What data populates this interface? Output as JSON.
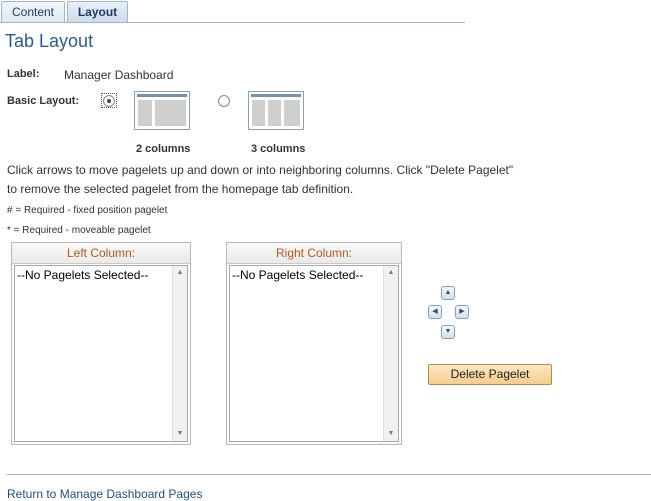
{
  "tabs": [
    {
      "label": "Content",
      "active": false
    },
    {
      "label": "Layout",
      "active": true
    }
  ],
  "page": {
    "title": "Tab Layout"
  },
  "form": {
    "label_caption": "Label:",
    "label_value": "Manager Dashboard",
    "basic_layout_caption": "Basic Layout:",
    "layouts": [
      {
        "caption": "2 columns",
        "selected": true
      },
      {
        "caption": "3 columns",
        "selected": false
      }
    ]
  },
  "instructions": {
    "line1": "Click arrows to move pagelets up and down or into neighboring columns. Click \"Delete Pagelet\"",
    "line2": "to remove the selected pagelet from the homepage tab definition.",
    "required_fixed": "# = Required - fixed position pagelet",
    "required_moveable": "* = Required - moveable pagelet"
  },
  "columns": {
    "left": {
      "header": "Left Column:",
      "items": [
        "--No Pagelets Selected--"
      ]
    },
    "right": {
      "header": "Right Column:",
      "items": [
        "--No Pagelets Selected--"
      ]
    }
  },
  "arrows": {
    "up": "up-arrow-icon",
    "left": "left-arrow-icon",
    "right": "right-arrow-icon",
    "down": "down-arrow-icon"
  },
  "buttons": {
    "delete_pagelet": "Delete Pagelet"
  },
  "footer": {
    "return_link": "Return to Manage Dashboard Pages"
  },
  "colors": {
    "title": "#2a5b93",
    "column_header": "#b05a1a",
    "button": "#f6cd8c",
    "link": "#1f4f8a"
  }
}
